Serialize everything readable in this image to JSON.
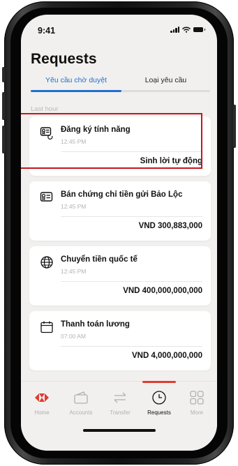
{
  "status_bar": {
    "time": "9:41"
  },
  "header": {
    "title": "Requests"
  },
  "tabs": [
    {
      "label": "Yêu cầu chờ duyệt",
      "active": true
    },
    {
      "label": "Loại yêu cầu",
      "active": false
    }
  ],
  "section_label": "Last hour",
  "requests": [
    {
      "icon": "feature-register-icon",
      "title": "Đăng ký tính năng",
      "time": "12:45 PM",
      "value": "Sinh lời tự động",
      "highlighted": true
    },
    {
      "icon": "certificate-icon",
      "title": "Bán chứng chỉ tiền gửi Bảo Lộc",
      "time": "12:45 PM",
      "value": "VND 300,883,000"
    },
    {
      "icon": "globe-icon",
      "title": "Chuyển tiền quốc tế",
      "time": "12:45 PM",
      "value": "VND 400,000,000,000"
    },
    {
      "icon": "calendar-icon",
      "title": "Thanh toán lương",
      "time": "07:00 AM",
      "value": "VND 4,000,000,000"
    }
  ],
  "bottom_nav": [
    {
      "label": "Home",
      "icon": "bank-logo-icon",
      "active": false
    },
    {
      "label": "Accounts",
      "icon": "wallet-icon",
      "active": false
    },
    {
      "label": "Transfer",
      "icon": "transfer-arrows-icon",
      "active": false
    },
    {
      "label": "Requests",
      "icon": "clock-icon",
      "active": true
    },
    {
      "label": "More",
      "icon": "grid-icon",
      "active": false
    }
  ],
  "colors": {
    "accent": "#1f6fd1",
    "brand_red": "#e03c31",
    "highlight_border": "#c4161c",
    "background": "#f1f0ee"
  }
}
